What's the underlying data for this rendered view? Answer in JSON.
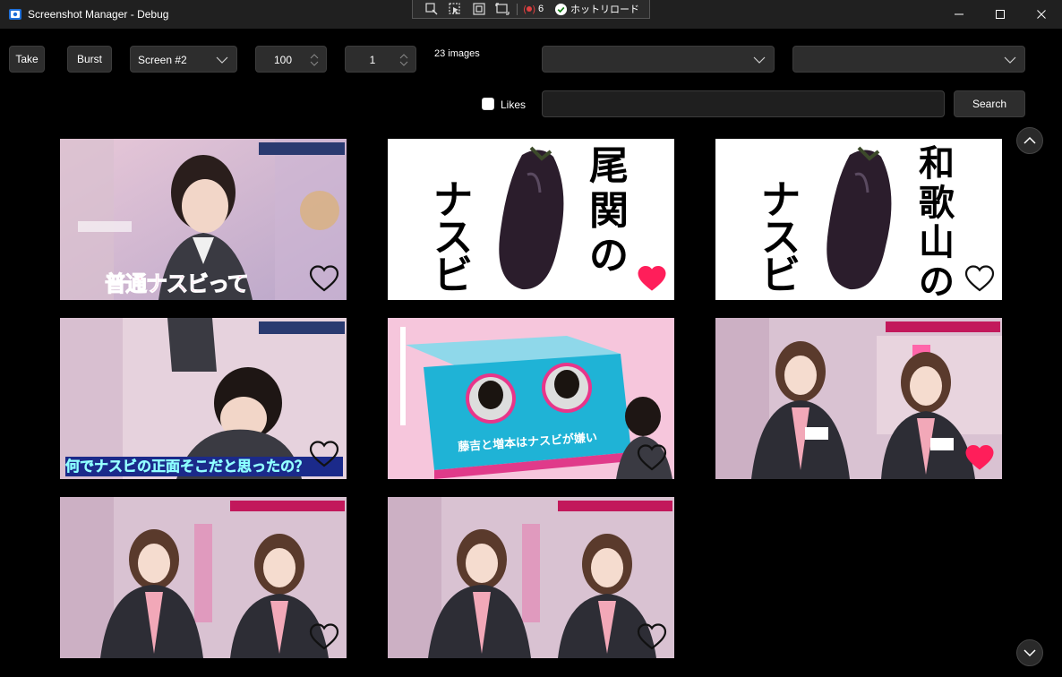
{
  "window": {
    "title": "Screenshot Manager - Debug",
    "debug_toolbar": {
      "count": "6",
      "hot_reload_label": "ホットリロード"
    }
  },
  "toolbar": {
    "take_label": "Take",
    "burst_label": "Burst",
    "screen_select": "Screen #2",
    "quality_value": "100",
    "interval_value": "1",
    "image_count": "23 images",
    "filter1_value": "",
    "filter2_value": ""
  },
  "search": {
    "likes_label": "Likes",
    "likes_checked": false,
    "query": "",
    "button_label": "Search"
  },
  "thumbnails": [
    {
      "caption": "普通ナスビって",
      "liked": false
    },
    {
      "caption": "尾関のナスビ",
      "liked": true
    },
    {
      "caption": "和歌山のナスビ",
      "liked": false
    },
    {
      "caption": "何でナスビの正面そこだと思ったの？",
      "liked": false
    },
    {
      "caption": "藤吉と増本はナスビが嫌い",
      "liked": false
    },
    {
      "caption": "",
      "liked": true
    },
    {
      "caption": "",
      "liked": false
    },
    {
      "caption": "",
      "liked": false
    }
  ],
  "colors": {
    "accent_heart": "#ff1e5a",
    "background": "#000000",
    "titlebar": "#202020"
  }
}
